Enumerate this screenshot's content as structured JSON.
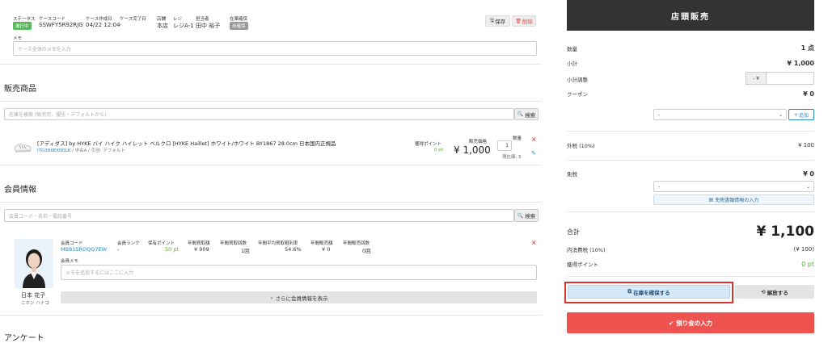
{
  "case": {
    "status_label": "ステータス",
    "status_value": "進行中",
    "code_label": "ケースコード",
    "code_value": "SSWFY5R92RJG",
    "created_label": "ケース作成日",
    "created_value": "04/22 12:04",
    "completed_label": "ケース完了日",
    "completed_value": "-",
    "store_label": "店舗",
    "store_value": "本店",
    "register_label": "レジ",
    "register_value": "レジA-1",
    "staff_label": "担当者",
    "staff_value": "田中 裕子",
    "stock_label": "在庫確保",
    "stock_value": "未確保",
    "save_label": "保存",
    "delete_label": "削除",
    "memo_label": "メモ",
    "memo_placeholder": "ケース全体のメモを入力"
  },
  "products": {
    "title": "販売商品",
    "search_placeholder": "在庫を検索 (販売可、優先・デフォルトから)",
    "search_button": "検索",
    "item": {
      "name": "[アディダス] by HYKE バイ ハイク ハイレット ベルクロ [HYKE Haillet] ホワイト/ホワイト BY1867 28.0cm 日本国内正規品",
      "sku": "ITG386EXN0LK",
      "meta": " / 中古A / 引当: デフォルト",
      "points_label": "獲得ポイント",
      "points_value": "0 pt",
      "price_label": "販売価格",
      "price_value": "¥ 1,000",
      "qty_label": "数量",
      "qty_value": "1",
      "stock_note": "現在庫: 5"
    }
  },
  "member": {
    "title": "会員情報",
    "search_placeholder": "会員コード・名前・電話番号",
    "search_button": "検索",
    "name": "日本 花子",
    "kana": "ニホン ハナコ",
    "columns": [
      {
        "label": "会員コード",
        "value": "MB81SROQQ7EW"
      },
      {
        "label": "会員ランク",
        "value": "-"
      },
      {
        "label": "保有ポイント",
        "value": "50 pt"
      },
      {
        "label": "年間買取額",
        "value": "¥ 909"
      },
      {
        "label": "年間買取回数",
        "value": "1回"
      },
      {
        "label": "年間平均買取粗利率",
        "value": "54.6%"
      },
      {
        "label": "年間販売額",
        "value": "¥ 0"
      },
      {
        "label": "年間販売回数",
        "value": "0回"
      }
    ],
    "memo_label": "会員メモ",
    "memo_placeholder": "メモを追加するにはここに入力",
    "more_button": "さらに会員情報を表示"
  },
  "survey": {
    "title": "アンケート"
  },
  "pos": {
    "header": "店頭販売",
    "qty_label": "数量",
    "qty_value": "1 点",
    "subtotal_label": "小計",
    "subtotal_value": "¥ 1,000",
    "adjust_label": "小計調整",
    "adjust_prefix": "- ¥",
    "coupon_label": "クーポン",
    "coupon_value": "¥ 0",
    "coupon_dash": "-",
    "coupon_select": "-",
    "coupon_add": "追加",
    "tax_ext_label": "外税 (10%)",
    "tax_ext_value": "¥ 100",
    "taxfree_label": "免税",
    "taxfree_value": "¥ 0",
    "taxfree_select": "-",
    "taxfree_button": "免税書類情報の入力",
    "total_label": "合計",
    "total_value": "¥ 1,100",
    "inner_tax_label": "内消費税 (10%)",
    "inner_tax_value": "(¥ 100)",
    "earn_label": "獲得ポイント",
    "earn_value": "0 pt",
    "reserve_button": "在庫を確保する",
    "release_button": "解放する",
    "deposit_button": "預り金の入力"
  },
  "colors": {
    "status_green": "#5cb85c",
    "badge_gray": "#9a9a9a",
    "danger": "#e04b4b",
    "header_dark": "#333333",
    "primary_light": "#d6e9f8",
    "highlight_red": "#d9342b",
    "deposit_red": "#ef5350"
  }
}
